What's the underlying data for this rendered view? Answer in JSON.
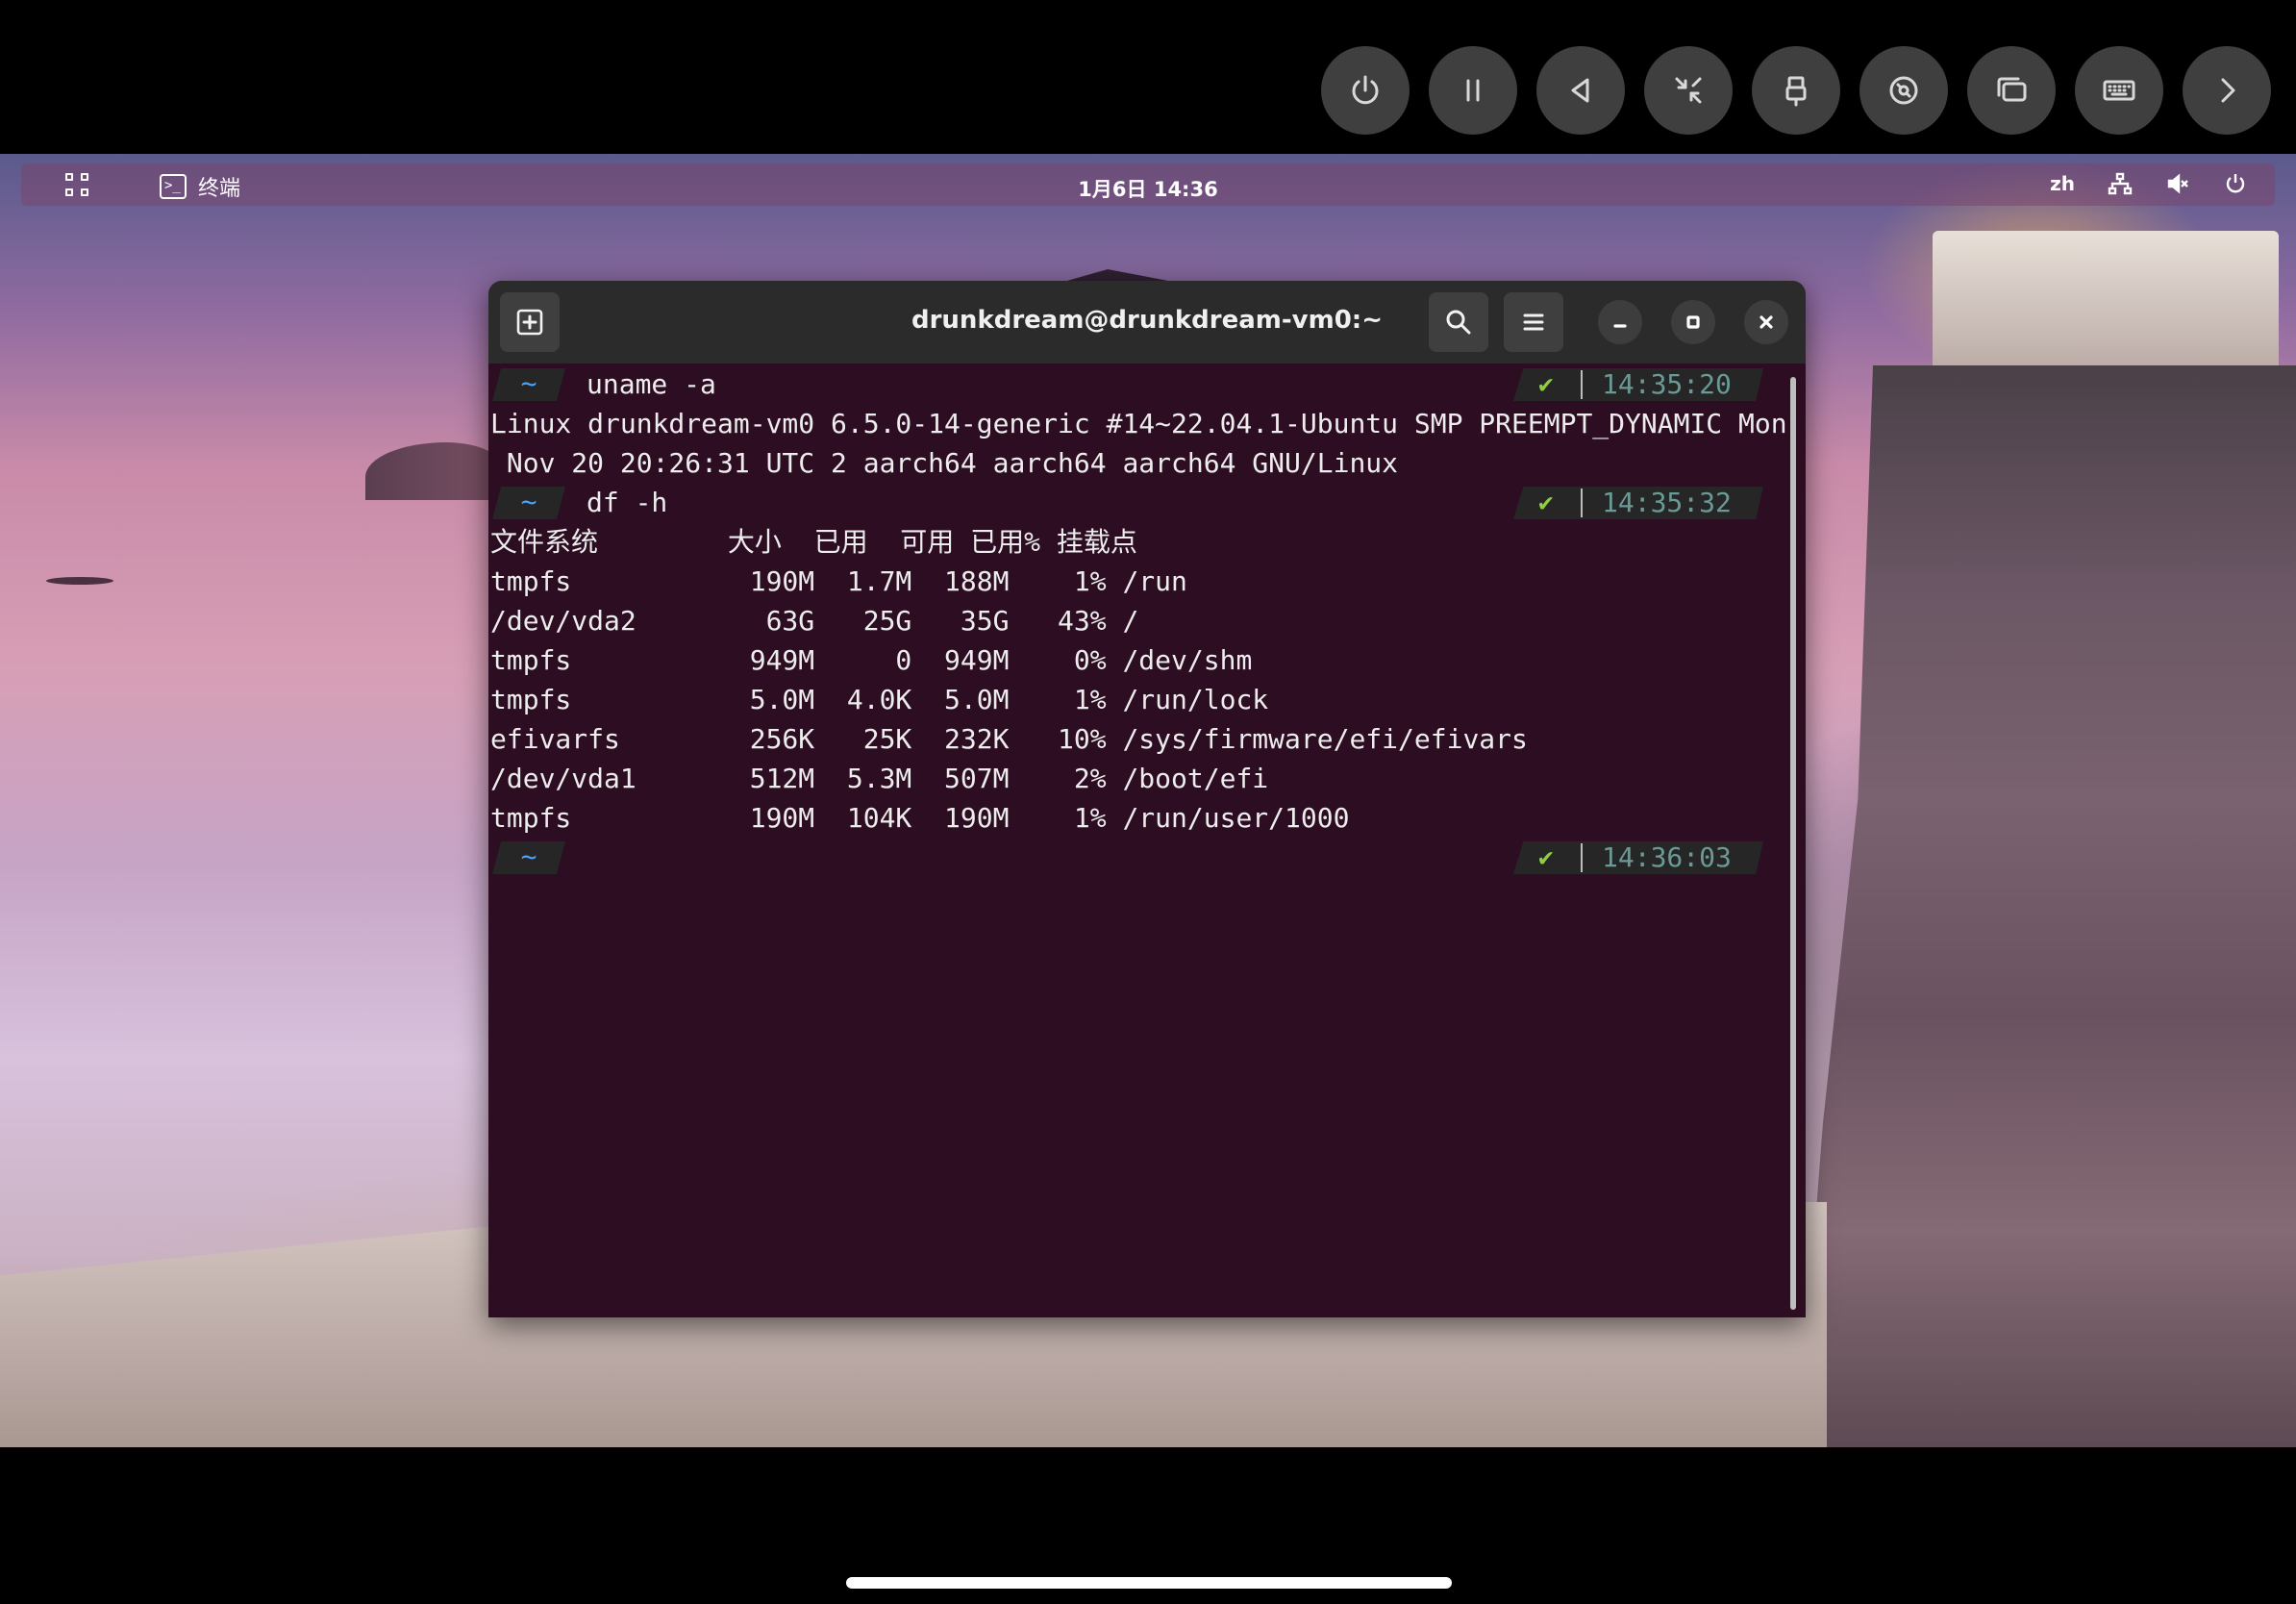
{
  "vm_toolbar": {
    "buttons": [
      {
        "icon": "power-icon"
      },
      {
        "icon": "pause-icon"
      },
      {
        "icon": "back-icon"
      },
      {
        "icon": "shrink-icon"
      },
      {
        "icon": "usb-icon"
      },
      {
        "icon": "disc-icon"
      },
      {
        "icon": "windows-icon"
      },
      {
        "icon": "keyboard-icon"
      },
      {
        "icon": "chevron-right-icon"
      }
    ]
  },
  "topbar": {
    "app_name": "终端",
    "terminal_glyph": ">_",
    "clock": "1月6日  14:36",
    "input_method": "zh",
    "colors": {
      "bg": "#78466e"
    }
  },
  "terminal": {
    "title": "drunkdream@drunkdream-vm0:~",
    "prompt_symbol": "~",
    "check_symbol": "✔",
    "blocks": [
      {
        "command": "uname -a",
        "time": "14:35:20"
      },
      {
        "command": "df -h",
        "time": "14:35:32"
      },
      {
        "command": "",
        "time": "14:36:03"
      }
    ],
    "uname_output": [
      "Linux drunkdream-vm0 6.5.0-14-generic #14~22.04.1-Ubuntu SMP PREEMPT_DYNAMIC Mon",
      " Nov 20 20:26:31 UTC 2 aarch64 aarch64 aarch64 GNU/Linux"
    ],
    "df_output": [
      "文件系统        大小  已用  可用 已用% 挂载点",
      "tmpfs           190M  1.7M  188M    1% /run",
      "/dev/vda2        63G   25G   35G   43% /",
      "tmpfs           949M     0  949M    0% /dev/shm",
      "tmpfs           5.0M  4.0K  5.0M    1% /run/lock",
      "efivarfs        256K   25K  232K   10% /sys/firmware/efi/efivars",
      "/dev/vda1       512M  5.3M  507M    2% /boot/efi",
      "tmpfs           190M  104K  190M    1% /run/user/1000"
    ],
    "colors": {
      "background": "#2d0d22",
      "headerbar": "#2b2b2b",
      "prompt_tilde": "#4aa3ff",
      "check": "#8ecf3f",
      "time": "#6a9a96"
    }
  }
}
